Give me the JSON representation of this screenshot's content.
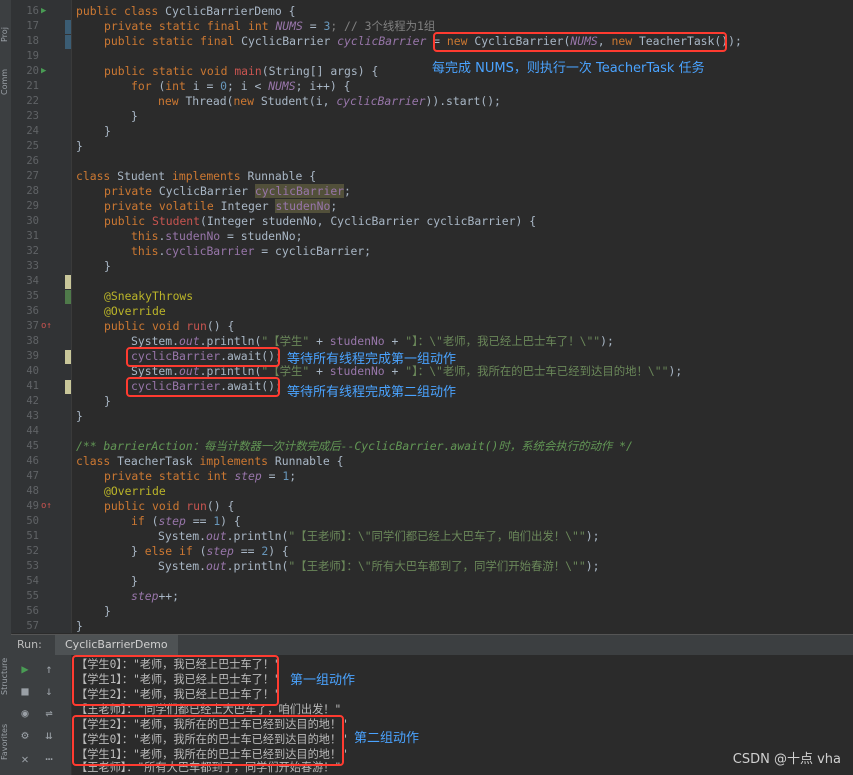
{
  "sidebar_labels": [
    "Proj",
    "Comm",
    "Structure",
    "Favorites"
  ],
  "line_numbers": [
    "16",
    "17",
    "18",
    "19",
    "20",
    "21",
    "22",
    "23",
    "24",
    "25",
    "26",
    "27",
    "28",
    "29",
    "30",
    "31",
    "32",
    "33",
    "34",
    "35",
    "36",
    "37",
    "38",
    "39",
    "40",
    "41",
    "42",
    "43",
    "44",
    "45",
    "46",
    "47",
    "48",
    "49",
    "50",
    "51",
    "52",
    "53",
    "54",
    "55",
    "56",
    "57"
  ],
  "code": {
    "l16": [
      "public class ",
      "CyclicBarrierDemo {"
    ],
    "l17": [
      "private static final int ",
      "NUMS",
      " = ",
      "3",
      "; // 3个线程为1组"
    ],
    "l18": [
      "public static final ",
      "CyclicBarrier ",
      "cyclicBarrier",
      " = ",
      "new ",
      "CyclicBarrier(",
      "NUMS",
      ", ",
      "new ",
      "TeacherTask());"
    ],
    "l20": [
      "public static void ",
      "main",
      "(String[] args) {"
    ],
    "l21": [
      "for ",
      "(",
      "int ",
      "i = ",
      "0",
      "; i < ",
      "NUMS",
      "; i++) {"
    ],
    "l22": [
      "new ",
      "Thread(",
      "new ",
      "Student(i, ",
      "cyclicBarrier",
      ")).start();"
    ],
    "l23": [
      "}"
    ],
    "l24": [
      "}"
    ],
    "l25": [
      "}"
    ],
    "l27": [
      "class ",
      "Student ",
      "implements ",
      "Runnable {"
    ],
    "l28": [
      "private ",
      "CyclicBarrier ",
      "cyclicBarrier",
      ";"
    ],
    "l29": [
      "private volatile ",
      "Integer ",
      "studenNo",
      ";"
    ],
    "l30": [
      "public ",
      "Student",
      "(Integer studenNo, CyclicBarrier cyclicBarrier) {"
    ],
    "l31": [
      "this",
      ".",
      "studenNo",
      " = studenNo;"
    ],
    "l32": [
      "this",
      ".",
      "cyclicBarrier",
      " = cyclicBarrier;"
    ],
    "l33": [
      "}"
    ],
    "l35": [
      "@SneakyThrows"
    ],
    "l36": [
      "@Override"
    ],
    "l37": [
      "public void ",
      "run",
      "() {"
    ],
    "l38": [
      "System.",
      "out",
      ".println(",
      "\"【学生\"",
      " + ",
      "studenNo",
      " + ",
      "\"】：\\\"老师，我已经上巴士车了！\\\"\"",
      ");"
    ],
    "l39": [
      "cyclicBarrier",
      ".await();"
    ],
    "l40": [
      "System.",
      "out",
      ".println(",
      "\"【学生\"",
      " + ",
      "studenNo",
      " + ",
      "\"】：\\\"老师，我所在的巴士车已经到达目的地！\\\"\"",
      ");"
    ],
    "l41": [
      "cyclicBarrier",
      ".await();"
    ],
    "l42": [
      "}"
    ],
    "l43": [
      "}"
    ],
    "l45": [
      "/** barrierAction：每当计数器一次计数完成后--CyclicBarrier.await()时，系统会执行的动作 */"
    ],
    "l46": [
      "class ",
      "TeacherTask ",
      "implements ",
      "Runnable {"
    ],
    "l47": [
      "private static int ",
      "step",
      " = ",
      "1",
      ";"
    ],
    "l48": [
      "@Override"
    ],
    "l49": [
      "public void ",
      "run",
      "() {"
    ],
    "l50": [
      "if ",
      "(",
      "step",
      " == ",
      "1",
      ") {"
    ],
    "l51": [
      "System.",
      "out",
      ".println(",
      "\"【王老师】：\\\"同学们都已经上大巴车了，咱们出发！\\\"\"",
      ");"
    ],
    "l52": [
      "} ",
      "else if ",
      "(",
      "step",
      " == ",
      "2",
      ") {"
    ],
    "l53": [
      "System.",
      "out",
      ".println(",
      "\"【王老师】：\\\"所有大巴车都到了，同学们开始春游！\\\"\"",
      ");"
    ],
    "l54": [
      "}"
    ],
    "l55": [
      "step",
      "++;"
    ],
    "l56": [
      "}"
    ],
    "l57": [
      "}"
    ]
  },
  "annotations": {
    "a1": "每完成 NUMS，则执行一次 TeacherTask 任务",
    "a2": "等待所有线程完成第一组动作",
    "a3": "等待所有线程完成第二组动作",
    "a4": "第一组动作",
    "a5": "第二组动作"
  },
  "run_panel": {
    "label": "Run:",
    "tab": "CyclicBarrierDemo"
  },
  "console": [
    "【学生0】：\"老师，我已经上巴士车了！\"",
    "【学生1】：\"老师，我已经上巴士车了！\"",
    "【学生2】：\"老师，我已经上巴士车了！\"",
    "【王老师】：\"同学们都已经上大巴车了，咱们出发！\"",
    "【学生2】：\"老师，我所在的巴士车已经到达目的地！\"",
    "【学生0】：\"老师，我所在的巴士车已经到达目的地！\"",
    "【学生1】：\"老师，我所在的巴士车已经到达目的地！\"",
    "【王老师】：\"所有大巴车都到了，同学们开始春游！\""
  ],
  "watermark": "CSDN @十点 vha",
  "colors": {
    "annotation_box": "#ff3b30",
    "annotation_text": "#4aa3ff",
    "keyword": "#cc7832",
    "string": "#6a8759",
    "field": "#9876aa"
  }
}
